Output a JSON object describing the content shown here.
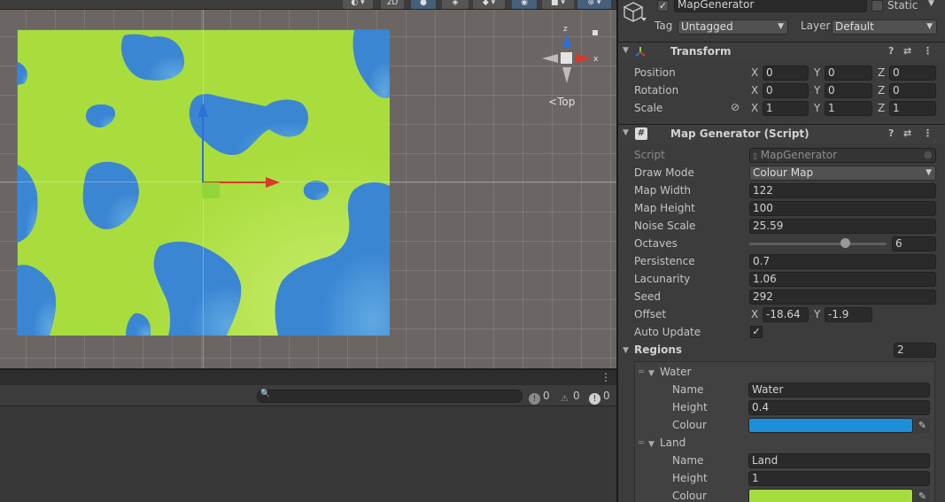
{
  "colors": {
    "water": "#3b86d3",
    "land": "#a9dd3e",
    "water_swatch": "#1b8fd8",
    "land_swatch": "#a6dd3e",
    "gizmo_x": "#d63a2a",
    "gizmo_y": "#8fd43b",
    "gizmo_z": "#2f6fd6"
  },
  "scene": {
    "toolbar": {
      "mode_2d": "2D"
    },
    "gizmo": {
      "label_y": "y",
      "label_x": "x",
      "label_z": "z",
      "view_label": "Top",
      "back_icon": "arrow-left-icon"
    }
  },
  "console": {
    "search_icon": "magnifier-icon",
    "log_count": "0",
    "warning_count": "0",
    "error_count": "0",
    "menu_icon": "kebab-icon"
  },
  "inspector": {
    "object_name": "MapGenerator",
    "active_checked": true,
    "static_label": "Static",
    "tag_label": "Tag",
    "tag_value": "Untagged",
    "layer_label": "Layer",
    "layer_value": "Default",
    "transform": {
      "title": "Transform",
      "position_label": "Position",
      "rotation_label": "Rotation",
      "scale_label": "Scale",
      "position": {
        "x": "0",
        "y": "0",
        "z": "0"
      },
      "rotation": {
        "x": "0",
        "y": "0",
        "z": "0"
      },
      "scale": {
        "x": "1",
        "y": "1",
        "z": "1"
      },
      "axis_x": "X",
      "axis_y": "Y",
      "axis_z": "Z"
    },
    "script_component": {
      "title": "Map Generator (Script)",
      "script_label": "Script",
      "script_value": "MapGenerator",
      "draw_mode_label": "Draw Mode",
      "draw_mode_value": "Colour Map",
      "map_width_label": "Map Width",
      "map_width": "122",
      "map_height_label": "Map Height",
      "map_height": "100",
      "noise_scale_label": "Noise Scale",
      "noise_scale": "25.59",
      "octaves_label": "Octaves",
      "octaves": "6",
      "octaves_slider_fraction": 0.7,
      "persistence_label": "Persistence",
      "persistence": "0.7",
      "lacunarity_label": "Lacunarity",
      "lacunarity": "1.06",
      "seed_label": "Seed",
      "seed": "292",
      "offset_label": "Offset",
      "offset_x": "-18.64",
      "offset_y": "-1.9",
      "auto_update_label": "Auto Update",
      "auto_update": true,
      "regions_label": "Regions",
      "regions_count": "2",
      "regions": [
        {
          "header": "Water",
          "name_label": "Name",
          "name": "Water",
          "height_label": "Height",
          "height": "0.4",
          "colour_label": "Colour"
        },
        {
          "header": "Land",
          "name_label": "Name",
          "name": "Land",
          "height_label": "Height",
          "height": "1",
          "colour_label": "Colour"
        }
      ]
    }
  }
}
